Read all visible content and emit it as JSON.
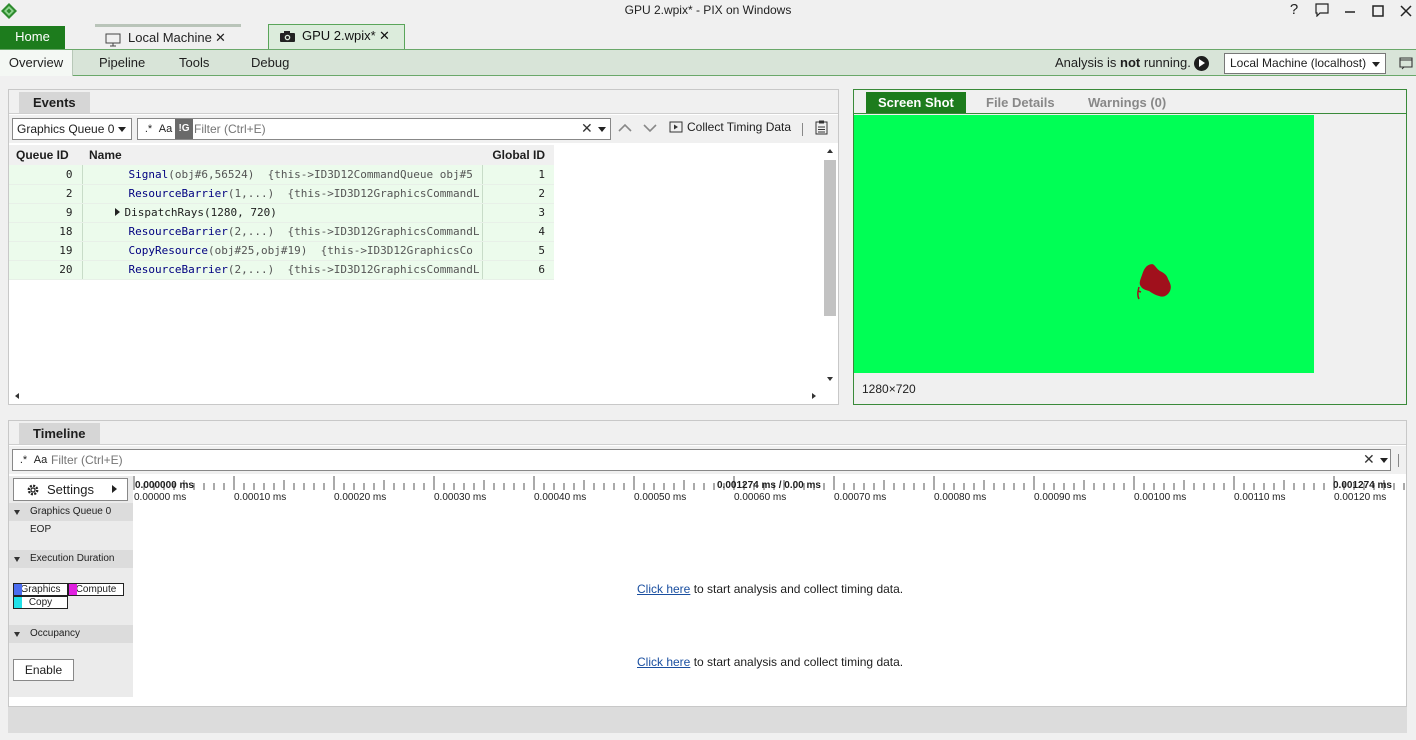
{
  "window": {
    "title": "GPU 2.wpix* - PIX on Windows",
    "buttons": [
      "?",
      "feedback",
      "minimize",
      "maximize",
      "close"
    ]
  },
  "doc_tabs": {
    "home": "Home",
    "local_machine": "Local Machine",
    "gpu_capture": "GPU 2.wpix*",
    "close_glyph": "✕"
  },
  "nav": {
    "tabs": [
      "Overview",
      "Pipeline",
      "Tools",
      "Debug"
    ],
    "active": "Overview",
    "analysis_prefix": "Analysis is ",
    "analysis_bold": "not",
    "analysis_suffix": " running.",
    "machine": "Local Machine (localhost)"
  },
  "events": {
    "tab_label": "Events",
    "queue": "Graphics Queue 0",
    "filter": {
      "regex": ".*",
      "case": "Aa",
      "g_toggle": "!G",
      "placeholder": "Filter (Ctrl+E)"
    },
    "collect_timing": "Collect Timing Data",
    "columns": [
      "Queue ID",
      "Name",
      "Global ID"
    ],
    "rows": [
      {
        "queue_id": "0",
        "fn": "Signal",
        "args": "(obj#6,56524)",
        "extra": "{this->ID3D12CommandQueue obj#5",
        "global_id": "1",
        "expandable": false
      },
      {
        "queue_id": "2",
        "fn": "ResourceBarrier",
        "args": "(1,...)",
        "extra": "{this->ID3D12GraphicsCommandL",
        "global_id": "2",
        "expandable": false
      },
      {
        "queue_id": "9",
        "fn": "DispatchRays(1280, 720)",
        "args": "",
        "extra": "",
        "global_id": "3",
        "expandable": true
      },
      {
        "queue_id": "18",
        "fn": "ResourceBarrier",
        "args": "(2,...)",
        "extra": "{this->ID3D12GraphicsCommandL",
        "global_id": "4",
        "expandable": false
      },
      {
        "queue_id": "19",
        "fn": "CopyResource",
        "args": "(obj#25,obj#19)",
        "extra": "{this->ID3D12GraphicsCo",
        "global_id": "5",
        "expandable": false
      },
      {
        "queue_id": "20",
        "fn": "ResourceBarrier",
        "args": "(2,...)",
        "extra": "{this->ID3D12GraphicsCommandL",
        "global_id": "6",
        "expandable": false
      }
    ]
  },
  "screenshot": {
    "tabs": [
      "Screen Shot",
      "File Details",
      "Warnings (0)"
    ],
    "active": "Screen Shot",
    "size": "1280×720",
    "bg_color": "#00ff55",
    "object_color": "#a0101c"
  },
  "timeline": {
    "tab_label": "Timeline",
    "filter": {
      "regex": ".*",
      "case": "Aa",
      "placeholder": "Filter (Ctrl+E)"
    },
    "settings": "Settings",
    "ruler": {
      "left_head": "0.000000 ms",
      "center_head": "0.001274 ms / 0.00 ms",
      "right_head": "0.001274 ms",
      "ticks": [
        "0.00000 ms",
        "0.00010 ms",
        "0.00020 ms",
        "0.00030 ms",
        "0.00040 ms",
        "0.00050 ms",
        "0.00060 ms",
        "0.00070 ms",
        "0.00080 ms",
        "0.00090 ms",
        "0.00100 ms",
        "0.00110 ms",
        "0.00120 ms"
      ]
    },
    "sections": {
      "eop": "Graphics Queue 0 EOP",
      "exec": "Execution Duration",
      "occupancy": "Occupancy"
    },
    "legend": {
      "graphics": "Graphics",
      "compute": "Compute",
      "copy": "Copy",
      "graphics_color": "#4a6cf0",
      "compute_color": "#e020e0",
      "copy_color": "#20e0e8"
    },
    "link_text": "Click here",
    "message": " to start analysis and collect timing data.",
    "enable": "Enable"
  }
}
